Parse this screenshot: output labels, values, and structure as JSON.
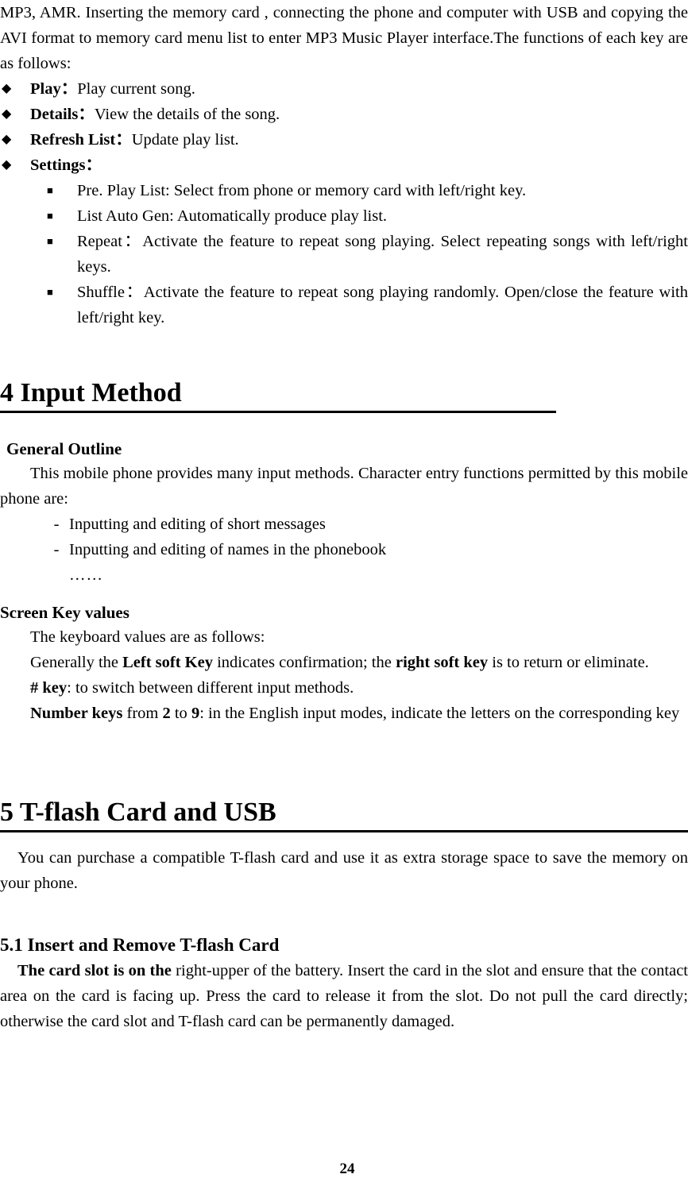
{
  "document": {
    "page_number": "24",
    "intro_paragraph": "MP3, AMR. Inserting the memory card , connecting the phone and computer with USB and copying the AVI format to memory card menu list to enter MP3 Music Player interface.The functions of each key are as follows:"
  },
  "key_functions": {
    "bullet_glyph": "◆",
    "items": [
      {
        "term": "Play",
        "separator": "：",
        "desc": "Play current song."
      },
      {
        "term": "Details",
        "separator": "：",
        "desc": "View the details of the song."
      },
      {
        "term": "Refresh List",
        "separator": "：",
        "desc": "Update play list."
      },
      {
        "term": "Settings",
        "separator": "：",
        "desc": ""
      }
    ]
  },
  "settings_sublist": {
    "bullet_glyph": "■",
    "items": [
      {
        "text": "Pre. Play List: Select from phone or memory card with left/right key."
      },
      {
        "text": "List Auto Gen: Automatically produce play list."
      },
      {
        "text": "Repeat：Activate the feature to repeat song playing. Select repeating songs with left/right keys."
      },
      {
        "text": "Shuffle：Activate the feature to repeat song playing randomly. Open/close the feature with left/right key."
      }
    ]
  },
  "chapter_4": {
    "title": "4 Input Method",
    "general_outline": {
      "heading": "General Outline",
      "paragraph": "This mobile phone provides many input methods. Character entry functions permitted by this mobile phone are:",
      "dash_glyph": "-",
      "items": [
        "Inputting and editing of short messages",
        "Inputting and editing of names in the phonebook"
      ],
      "ellipsis": "……"
    },
    "screen_key_values": {
      "heading": "Screen Key values",
      "line_1": "The keyboard values are as follows:",
      "line_2": {
        "pre": "Generally the ",
        "bold_1": "Left soft Key",
        "mid": " indicates confirmation; the ",
        "bold_2": "right soft key",
        "post": " is to return or eliminate."
      },
      "line_3": {
        "bold": "# key",
        "rest": ": to switch between different input methods."
      },
      "line_4": {
        "bold_1": "Number keys",
        "mid_1": " from ",
        "bold_2": "2",
        "mid_2": " to ",
        "bold_3": "9",
        "post": ": in the English input modes, indicate the letters on the corresponding key"
      }
    }
  },
  "chapter_5": {
    "title": "5 T-flash Card and USB",
    "intro": "You can purchase a compatible T-flash card and use it as extra storage space to save the memory on your phone.",
    "section_5_1": {
      "heading": "5.1 Insert and Remove T-flash Card",
      "bold_lead": "The card slot is on the",
      "body": " right-upper of the battery. Insert the card in the slot and ensure that the contact area on the card is facing up. Press the card to release it from the slot. Do not pull the card directly; otherwise the card slot and T-flash card can be permanently damaged."
    }
  }
}
